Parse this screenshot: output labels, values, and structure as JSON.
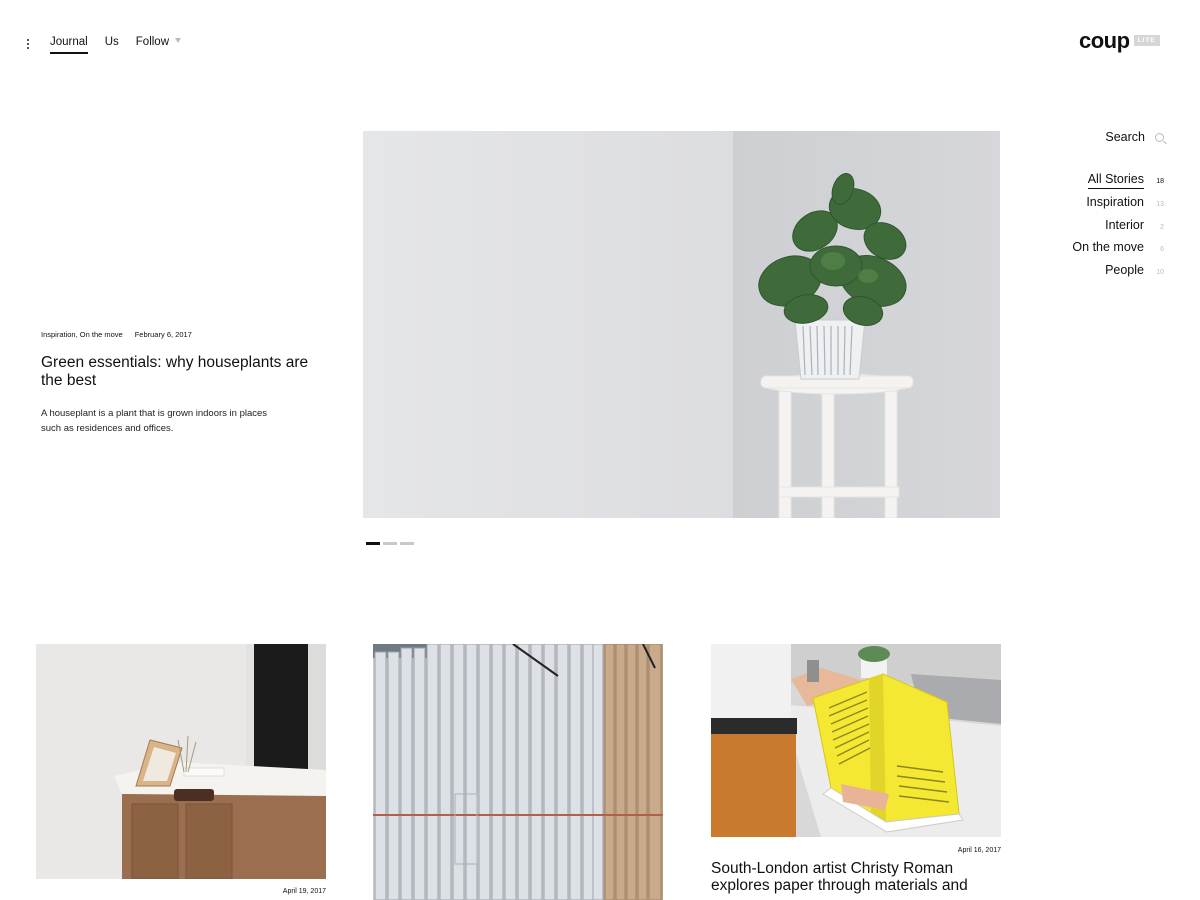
{
  "header": {
    "nav": [
      {
        "label": "Journal",
        "active": true
      },
      {
        "label": "Us",
        "active": false
      },
      {
        "label": "Follow",
        "active": false
      }
    ],
    "logo_text": "coup",
    "logo_badge": "LITE"
  },
  "sidebar": {
    "search_label": "Search",
    "categories": [
      {
        "label": "All Stories",
        "count": "18"
      },
      {
        "label": "Inspiration",
        "count": "13"
      },
      {
        "label": "Interior",
        "count": "2"
      },
      {
        "label": "On the move",
        "count": "6"
      },
      {
        "label": "People",
        "count": "10"
      }
    ]
  },
  "featured": {
    "categories": "Inspiration, On the move",
    "date": "February 6, 2017",
    "title": "Green essentials: why houseplants are the best",
    "excerpt": "A houseplant is a plant that is grown indoors in places such as residences and offices.",
    "slider_active": 1,
    "slider_total": 3
  },
  "cards": [
    {
      "date": "April 19, 2017"
    },
    {
      "date": ""
    },
    {
      "date": "April 16, 2017",
      "title": "South-London artist Christy Roman explores paper through materials and"
    }
  ],
  "colors": {
    "text": "#111111",
    "muted": "#bbbbbb",
    "magazine_yellow": "#f2e83a"
  }
}
